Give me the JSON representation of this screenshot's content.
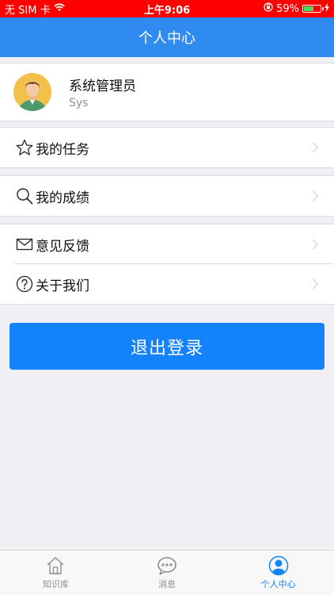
{
  "status_bar": {
    "carrier": "无 SIM 卡",
    "time": "上午9:06",
    "battery": "59%",
    "battery_level": 0.59
  },
  "nav": {
    "title": "个人中心"
  },
  "profile": {
    "name": "系统管理员",
    "username": "Sys"
  },
  "menu": {
    "tasks": "我的任务",
    "scores": "我的成绩",
    "feedback": "意见反馈",
    "about": "关于我们"
  },
  "logout_label": "退出登录",
  "tabs": [
    {
      "label": "知识库",
      "icon": "home-icon"
    },
    {
      "label": "消息",
      "icon": "message-icon"
    },
    {
      "label": "个人中心",
      "icon": "user-icon",
      "active": true
    }
  ],
  "colors": {
    "nav": "#2f8bf0",
    "accent": "#1382fb",
    "status_bar": "#ff0000"
  }
}
